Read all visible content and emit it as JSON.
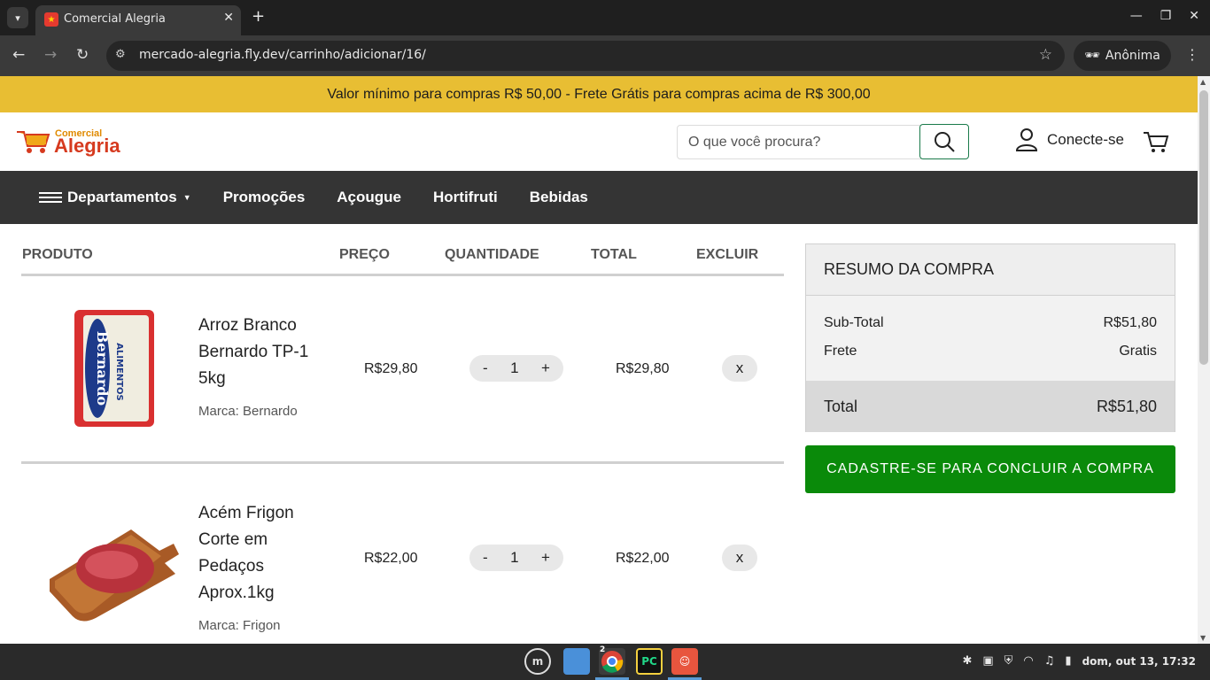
{
  "browser": {
    "tab_title": "Comercial Alegria",
    "url": "mercado-alegria.fly.dev/carrinho/adicionar/16/",
    "profile_label": "Anônima"
  },
  "promo_bar": "Valor mínimo para compras R$ 50,00 - Frete Grátis para compras acima de R$ 300,00",
  "header": {
    "logo_small": "Comercial",
    "logo_big": "Alegria",
    "search_placeholder": "O que você procura?",
    "login_label": "Conecte-se"
  },
  "nav": {
    "departments": "Departamentos",
    "items": [
      "Promoções",
      "Açougue",
      "Hortifruti",
      "Bebidas"
    ]
  },
  "cart": {
    "headers": {
      "product": "PRODUTO",
      "price": "PREÇO",
      "quantity": "QUANTIDADE",
      "total": "TOTAL",
      "delete": "EXCLUIR"
    },
    "qty_minus": "-",
    "qty_plus": "+",
    "delete_label": "x",
    "items": [
      {
        "name": "Arroz Branco Bernardo TP-1 5kg",
        "brand": "Marca: Bernardo",
        "price": "R$29,80",
        "quantity": "1",
        "total": "R$29,80"
      },
      {
        "name": "Acém Frigon Corte em Pedaços Aprox.1kg",
        "brand": "Marca: Frigon",
        "price": "R$22,00",
        "quantity": "1",
        "total": "R$22,00"
      }
    ]
  },
  "summary": {
    "title": "RESUMO DA COMPRA",
    "subtotal_label": "Sub-Total",
    "subtotal_value": "R$51,80",
    "shipping_label": "Frete",
    "shipping_value": "Gratis",
    "total_label": "Total",
    "total_value": "R$51,80",
    "checkout_label": "CADASTRE-SE PARA CONCLUIR A COMPRA"
  },
  "taskbar": {
    "chrome_badge": "2",
    "clock": "dom, out 13, 17:32"
  },
  "colors": {
    "promo_bg": "#e8be33",
    "nav_bg": "#343434",
    "checkout_green": "#0a8a0a",
    "brand_red": "#d63a1f"
  }
}
